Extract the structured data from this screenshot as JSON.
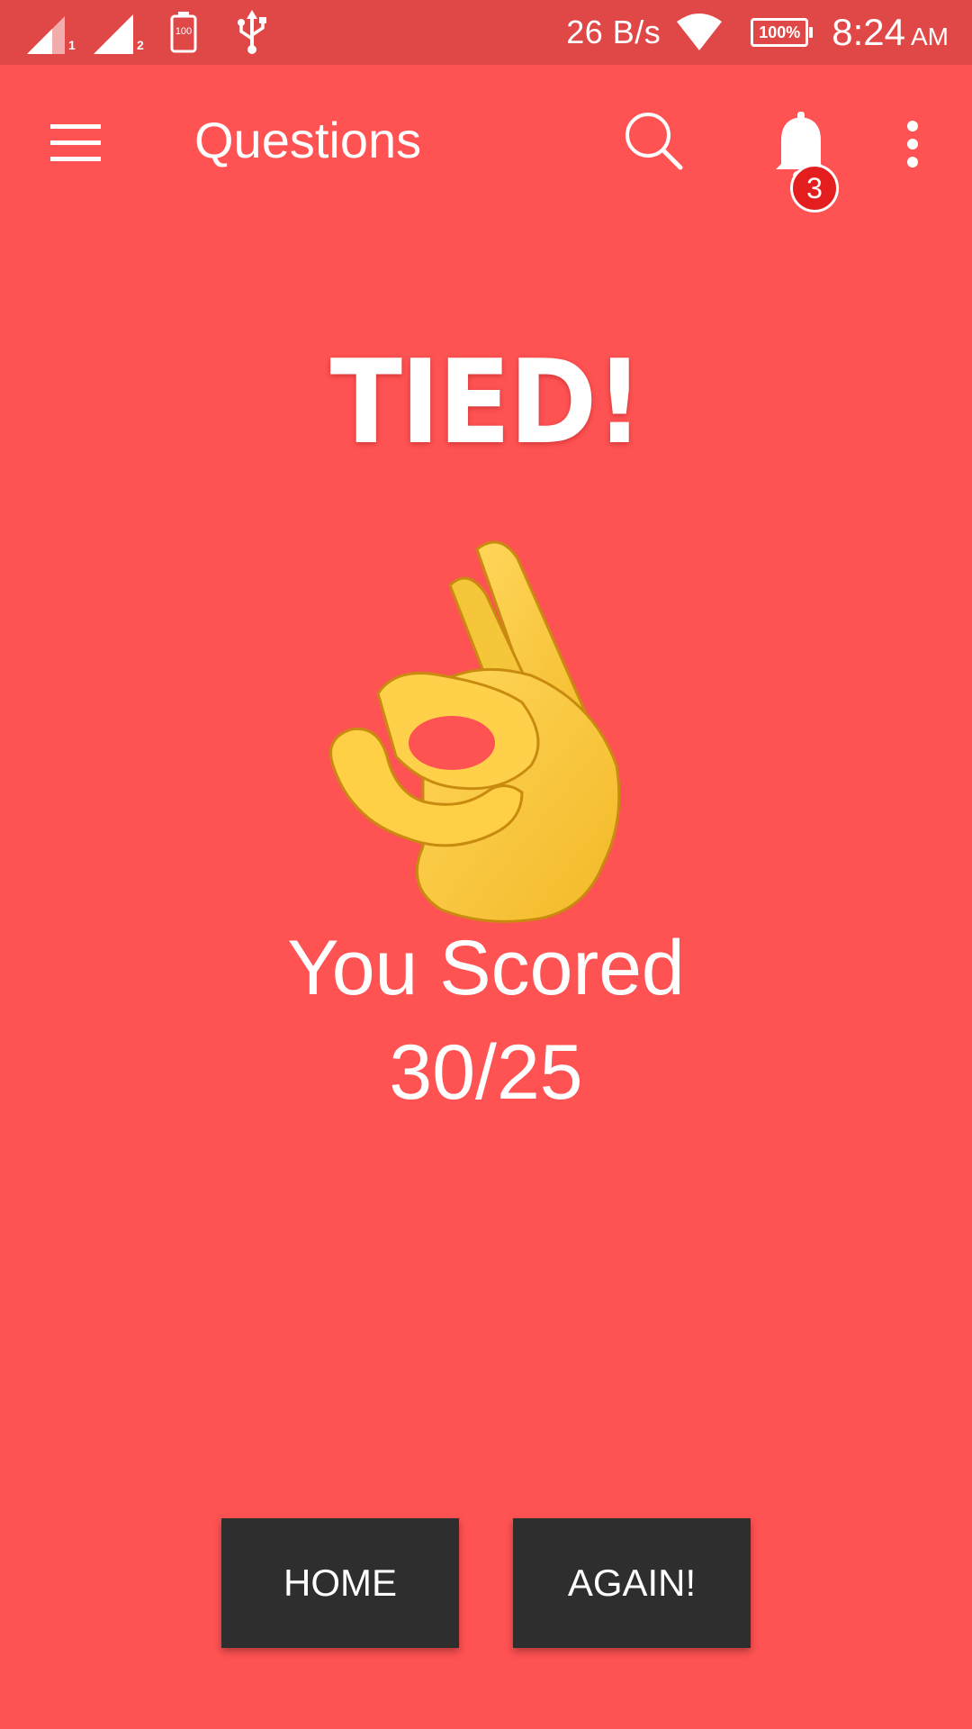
{
  "status_bar": {
    "sim1": "1",
    "sim2": "2",
    "battery_saver": "100",
    "net_speed": "26 B/s",
    "battery": "100%",
    "time": "8:24",
    "ampm": "AM"
  },
  "app_bar": {
    "title": "Questions",
    "notification_count": "3",
    "icons": [
      "menu-icon",
      "search-icon",
      "bell-icon",
      "more-vert-icon"
    ]
  },
  "result": {
    "title": "TIED!",
    "emoji": "ok-hand-emoji",
    "score_label": "You Scored",
    "score_value": "30/25"
  },
  "buttons": {
    "home": "HOME",
    "again": "AGAIN!"
  },
  "colors": {
    "background": "#ff5252",
    "status_bar": "#e04848",
    "button": "#2e2e2e",
    "badge": "#e41e1e",
    "text": "#ffffff"
  }
}
